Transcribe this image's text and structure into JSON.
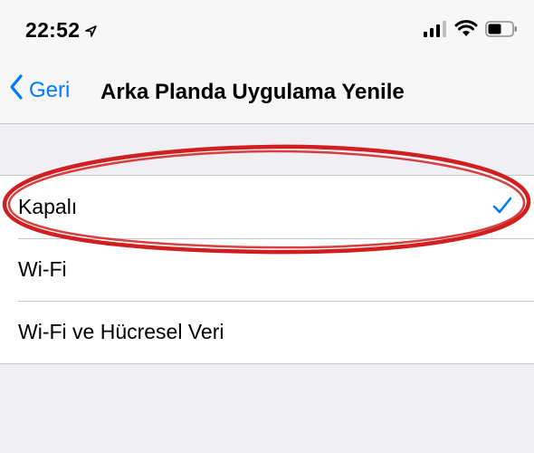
{
  "status_bar": {
    "time": "22:52",
    "location_icon": "location-arrow-icon",
    "signal_icon": "cellular-signal-icon",
    "wifi_icon": "wifi-icon",
    "battery_icon": "battery-icon"
  },
  "nav": {
    "back_label": "Geri",
    "title": "Arka Planda Uygulama Yenile"
  },
  "options": [
    {
      "label": "Kapalı",
      "selected": true
    },
    {
      "label": "Wi-Fi",
      "selected": false
    },
    {
      "label": "Wi-Fi ve Hücresel Veri",
      "selected": false
    }
  ],
  "colors": {
    "accent": "#007aff",
    "annotation": "#d11f1f",
    "background": "#efeff4"
  }
}
